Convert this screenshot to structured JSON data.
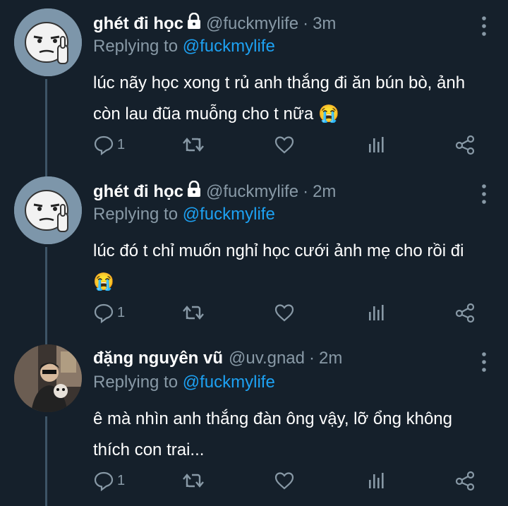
{
  "tweets": [
    {
      "name": "ghét đi học",
      "handle": "@fuckmylife",
      "sep": "·",
      "time": "3m",
      "replying_prefix": "Replying to",
      "replying_to": "@fuckmylife",
      "text": "lúc nãy học xong t rủ anh thắng đi ăn bún bò, ảnh còn lau đũa muỗng cho t nữa 😭",
      "reply_count": "1",
      "protected": true,
      "avatar": "meme-face-avatar"
    },
    {
      "name": "ghét đi học",
      "handle": "@fuckmylife",
      "sep": "·",
      "time": "2m",
      "replying_prefix": "Replying to",
      "replying_to": "@fuckmylife",
      "text": "lúc đó t chỉ muốn nghỉ học cưới ảnh mẹ cho rồi đi 😭",
      "reply_count": "1",
      "protected": true,
      "avatar": "meme-face-avatar"
    },
    {
      "name": "đặng nguyên vũ",
      "handle": "@uv.gnad",
      "sep": "·",
      "time": "2m",
      "replying_prefix": "Replying to",
      "replying_to": "@fuckmylife",
      "text": "ê mà nhìn anh thắng đàn ông vậy, lỡ ổng không thích con trai...",
      "reply_count": "1",
      "protected": false,
      "avatar": "photo-avatar"
    }
  ],
  "colors": {
    "background": "#15202b",
    "secondary_text": "#8899a6",
    "link": "#1da1f2",
    "thread_line": "#3d5466"
  },
  "icons": [
    "lock-icon",
    "more-icon",
    "reply-icon",
    "retweet-icon",
    "like-icon",
    "analytics-icon",
    "share-icon"
  ]
}
